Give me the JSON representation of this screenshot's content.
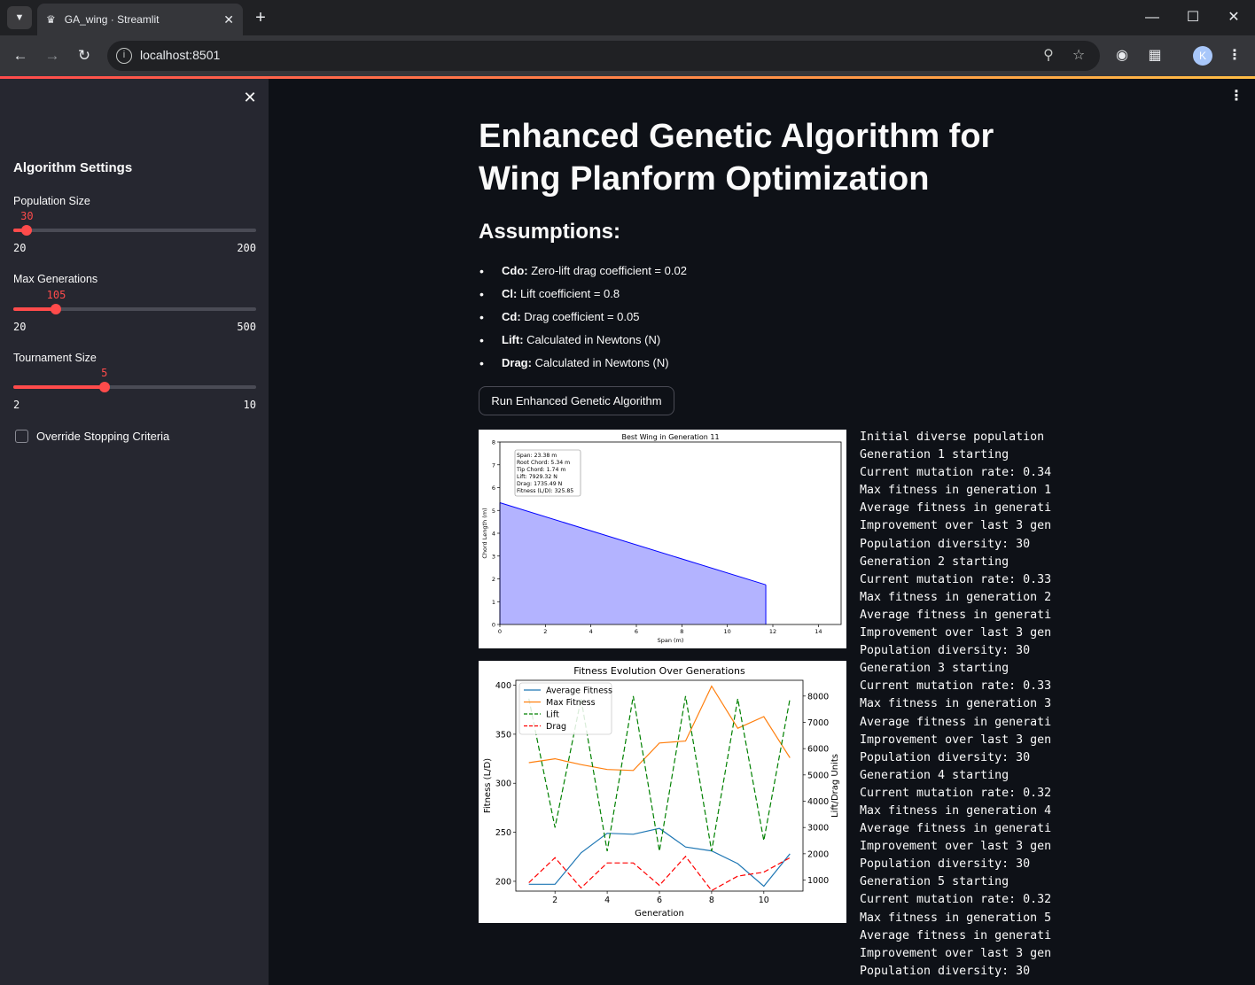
{
  "browser": {
    "tab_title": "GA_wing · Streamlit",
    "url": "localhost:8501",
    "avatar_initial": "K"
  },
  "sidebar": {
    "title": "Algorithm Settings",
    "sliders": [
      {
        "label": "Population Size",
        "value": "30",
        "min": "20",
        "max": "200",
        "fraction": 0.056
      },
      {
        "label": "Max Generations",
        "value": "105",
        "min": "20",
        "max": "500",
        "fraction": 0.177
      },
      {
        "label": "Tournament Size",
        "value": "5",
        "min": "2",
        "max": "10",
        "fraction": 0.375
      }
    ],
    "checkbox_label": "Override Stopping Criteria",
    "checkbox_checked": false
  },
  "main": {
    "title": "Enhanced Genetic Algorithm for Wing Planform Optimization",
    "assumptions_title": "Assumptions:",
    "assumptions": [
      {
        "key": "Cdo:",
        "text": " Zero-lift drag coefficient = 0.02"
      },
      {
        "key": "Cl:",
        "text": " Lift coefficient = 0.8"
      },
      {
        "key": "Cd:",
        "text": " Drag coefficient = 0.05"
      },
      {
        "key": "Lift:",
        "text": " Calculated in Newtons (N)"
      },
      {
        "key": "Drag:",
        "text": " Calculated in Newtons (N)"
      }
    ],
    "run_button": "Run Enhanced Genetic Algorithm"
  },
  "chart_data": [
    {
      "type": "area",
      "title": "Best Wing in Generation 11",
      "xlabel": "Span (m)",
      "ylabel": "Chord Length (m)",
      "xlim": [
        0,
        15
      ],
      "ylim": [
        0,
        8
      ],
      "xticks": [
        "0",
        "2",
        "4",
        "6",
        "8",
        "10",
        "12",
        "14"
      ],
      "yticks": [
        "0",
        "1",
        "2",
        "3",
        "4",
        "5",
        "6",
        "7",
        "8"
      ],
      "x": [
        0,
        11.69
      ],
      "y": [
        5.34,
        1.74
      ],
      "color": "#0000ff",
      "fill": "#b3b3ff",
      "annotation": [
        "Span: 23.38 m",
        "Root Chord: 5.34 m",
        "Tip Chord: 1.74 m",
        "Lift: 7929.32 N",
        "Drag: 1735.49 N",
        "Fitness (L/D): 325.85"
      ]
    },
    {
      "type": "line",
      "title": "Fitness Evolution Over Generations",
      "xlabel": "Generation",
      "ylabel": "Fitness (L/D)",
      "ylabel2": "Lift/Drag Units",
      "xlim": [
        0.5,
        11.5
      ],
      "ylim": [
        190,
        405
      ],
      "y2lim": [
        580,
        8600
      ],
      "xticks": [
        "2",
        "4",
        "6",
        "8",
        "10"
      ],
      "yticks": [
        "200",
        "250",
        "300",
        "350",
        "400"
      ],
      "y2ticks": [
        "1000",
        "2000",
        "3000",
        "4000",
        "5000",
        "6000",
        "7000",
        "8000"
      ],
      "x": [
        1,
        2,
        3,
        4,
        5,
        6,
        7,
        8,
        9,
        10,
        11
      ],
      "legend": "top-left",
      "series": [
        {
          "name": "Average Fitness",
          "axis": "left",
          "color": "#1f77b4",
          "dash": "",
          "values": [
            197,
            197,
            229,
            249,
            248,
            254,
            235,
            231,
            218,
            195,
            228
          ]
        },
        {
          "name": "Max Fitness",
          "axis": "left",
          "color": "#ff7f0e",
          "dash": "",
          "values": [
            321,
            325,
            319,
            314,
            313,
            341,
            343,
            399,
            356,
            368,
            326
          ]
        },
        {
          "name": "Lift",
          "axis": "right",
          "color": "#008000",
          "dash": "6,3",
          "values": [
            7900,
            3000,
            7900,
            2100,
            8000,
            2100,
            8000,
            2100,
            7900,
            2500,
            7900
          ]
        },
        {
          "name": "Drag",
          "axis": "right",
          "color": "#ff0000",
          "dash": "6,3",
          "values": [
            900,
            1850,
            700,
            1650,
            1650,
            800,
            1900,
            600,
            1150,
            1300,
            1850
          ]
        }
      ]
    }
  ],
  "log_lines": [
    "Initial diverse population",
    "Generation 1 starting",
    "Current mutation rate: 0.34",
    "Max fitness in generation 1",
    "Average fitness in generati",
    "Improvement over last 3 gen",
    "Population diversity: 30",
    "Generation 2 starting",
    "Current mutation rate: 0.33",
    "Max fitness in generation 2",
    "Average fitness in generati",
    "Improvement over last 3 gen",
    "Population diversity: 30",
    "Generation 3 starting",
    "Current mutation rate: 0.33",
    "Max fitness in generation 3",
    "Average fitness in generati",
    "Improvement over last 3 gen",
    "Population diversity: 30",
    "Generation 4 starting",
    "Current mutation rate: 0.32",
    "Max fitness in generation 4",
    "Average fitness in generati",
    "Improvement over last 3 gen",
    "Population diversity: 30",
    "Generation 5 starting",
    "Current mutation rate: 0.32",
    "Max fitness in generation 5",
    "Average fitness in generati",
    "Improvement over last 3 gen",
    "Population diversity: 30"
  ]
}
